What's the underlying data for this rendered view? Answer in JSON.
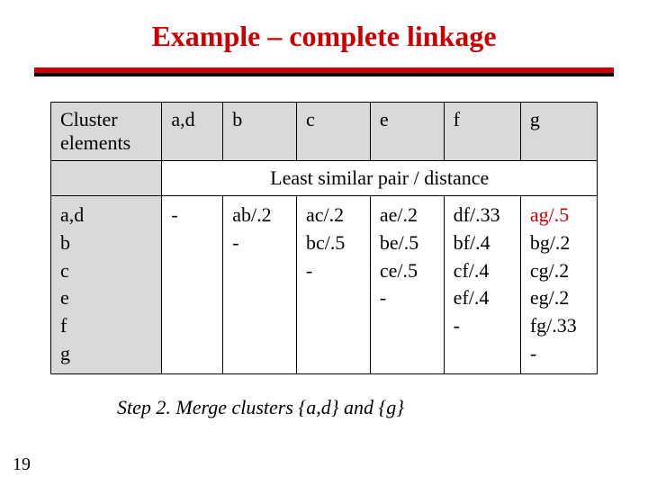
{
  "title": "Example – complete linkage",
  "page_number": "19",
  "header": {
    "corner": "Cluster elements",
    "cols": [
      "a,d",
      "b",
      "c",
      "e",
      "f",
      "g"
    ]
  },
  "subheader": "Least similar pair / distance",
  "row_labels": [
    "a,d",
    "b",
    "c",
    "e",
    "f",
    "g"
  ],
  "cells": {
    "c_ad": [
      "-"
    ],
    "c_b": [
      "ab/.2",
      "-"
    ],
    "c_c": [
      "ac/.2",
      "bc/.5",
      "-"
    ],
    "c_e": [
      "ae/.2",
      "be/.5",
      "ce/.5",
      "-"
    ],
    "c_f": [
      "df/.33",
      "bf/.4",
      "cf/.4",
      "ef/.4",
      "-"
    ],
    "c_g": [
      "ag/.5",
      "bg/.2",
      "cg/.2",
      "eg/.2",
      "fg/.33",
      "-"
    ]
  },
  "step_text": "Step 2.  Merge clusters {a,d} and {g}",
  "chart_data": {
    "type": "table",
    "title": "Complete-linkage distance matrix (least similar pair / distance)",
    "row_labels": [
      "a,d",
      "b",
      "c",
      "e",
      "f",
      "g"
    ],
    "col_labels": [
      "a,d",
      "b",
      "c",
      "e",
      "f",
      "g"
    ],
    "pairs": [
      {
        "row": "a,d",
        "col": "a,d",
        "pair": null,
        "distance": 0
      },
      {
        "row": "a,d",
        "col": "b",
        "pair": "ab",
        "distance": 0.2
      },
      {
        "row": "a,d",
        "col": "c",
        "pair": "ac",
        "distance": 0.2
      },
      {
        "row": "a,d",
        "col": "e",
        "pair": "ae",
        "distance": 0.2
      },
      {
        "row": "a,d",
        "col": "f",
        "pair": "df",
        "distance": 0.33
      },
      {
        "row": "a,d",
        "col": "g",
        "pair": "ag",
        "distance": 0.5
      },
      {
        "row": "b",
        "col": "c",
        "pair": "bc",
        "distance": 0.5
      },
      {
        "row": "b",
        "col": "e",
        "pair": "be",
        "distance": 0.5
      },
      {
        "row": "b",
        "col": "f",
        "pair": "bf",
        "distance": 0.4
      },
      {
        "row": "b",
        "col": "g",
        "pair": "bg",
        "distance": 0.2
      },
      {
        "row": "c",
        "col": "e",
        "pair": "ce",
        "distance": 0.5
      },
      {
        "row": "c",
        "col": "f",
        "pair": "cf",
        "distance": 0.4
      },
      {
        "row": "c",
        "col": "g",
        "pair": "cg",
        "distance": 0.2
      },
      {
        "row": "e",
        "col": "f",
        "pair": "ef",
        "distance": 0.4
      },
      {
        "row": "e",
        "col": "g",
        "pair": "eg",
        "distance": 0.2
      },
      {
        "row": "f",
        "col": "g",
        "pair": "fg",
        "distance": 0.33
      }
    ],
    "merge_step": {
      "step": 2,
      "merge": [
        "a,d",
        "g"
      ],
      "distance": 0.5
    }
  }
}
